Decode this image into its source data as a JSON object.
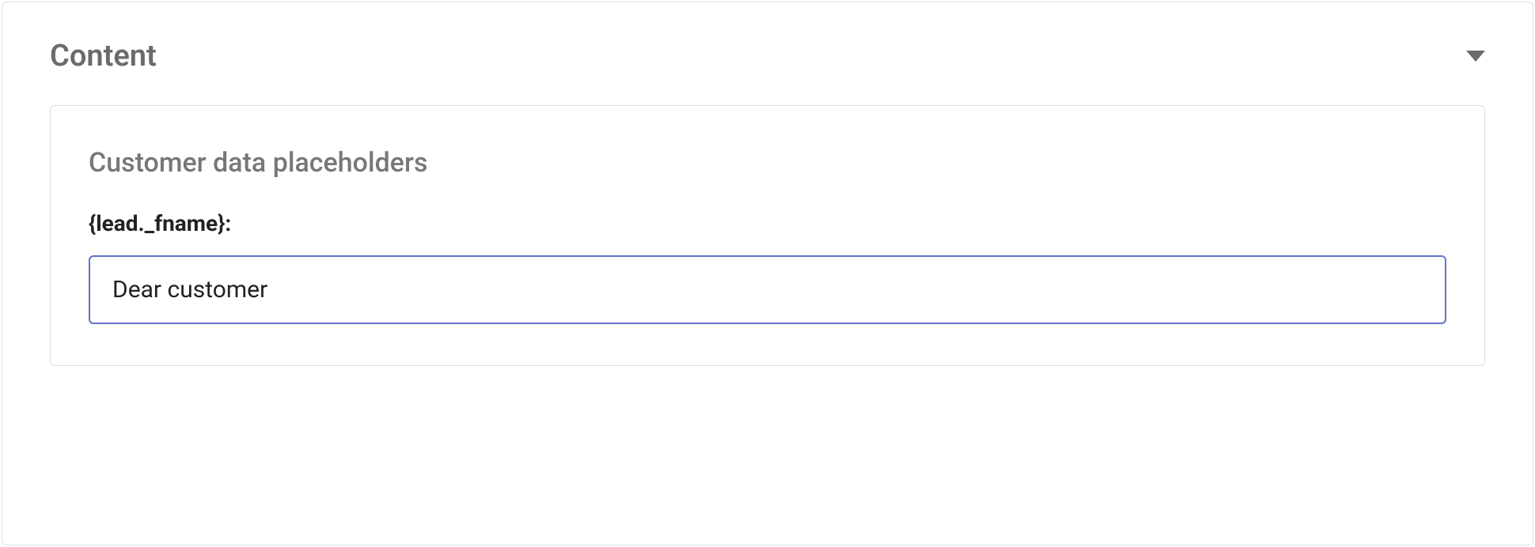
{
  "section": {
    "title": "Content"
  },
  "card": {
    "heading": "Customer data placeholders",
    "field": {
      "label": "{lead._fname}:",
      "value": "Dear customer"
    }
  }
}
